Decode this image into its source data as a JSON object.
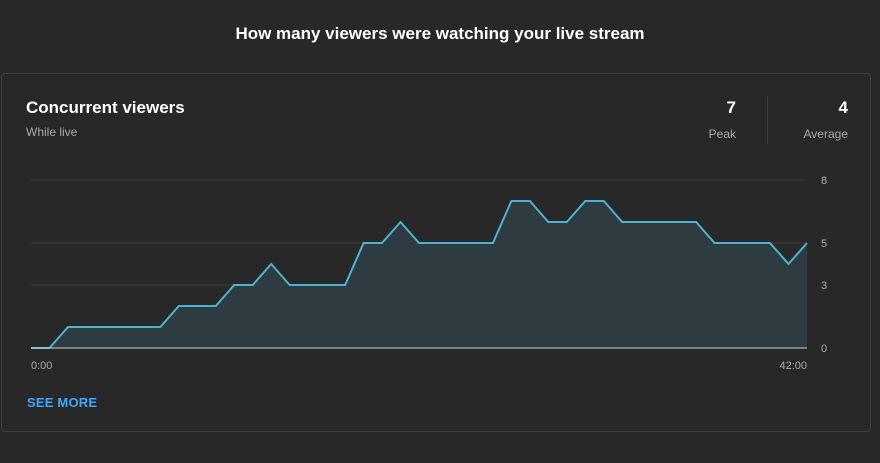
{
  "page": {
    "title": "How many viewers were watching your live stream"
  },
  "card": {
    "title": "Concurrent viewers",
    "subtitle": "While live",
    "stats": [
      {
        "value": "7",
        "label": "Peak"
      },
      {
        "value": "4",
        "label": "Average"
      }
    ],
    "see_more_label": "SEE MORE"
  },
  "chart_data": {
    "type": "area",
    "title": "",
    "xlabel": "",
    "ylabel": "",
    "x_tick_labels": [
      "0:00",
      "42:00"
    ],
    "x_range_minutes": [
      0,
      42
    ],
    "y_ticks": [
      0,
      3,
      5,
      8
    ],
    "y_tick_labels": [
      "0",
      "3",
      "5",
      "8"
    ],
    "ylim": [
      0,
      8
    ],
    "grid": true,
    "series": [
      {
        "x": [
          0,
          1.0,
          2.0,
          3.0,
          7.0,
          8.0,
          10.0,
          11.0,
          12.0,
          13.0,
          14.0,
          15.0,
          17.0,
          18.0,
          19.0,
          20.0,
          21.0,
          22.0,
          25.0,
          26.0,
          27.0,
          28.0,
          29.0,
          30.0,
          31.0,
          32.0,
          33.0,
          36.0,
          37.0,
          40.0,
          41.0,
          42.0
        ],
        "y": [
          0,
          0,
          1,
          1,
          1,
          2,
          2,
          3,
          3,
          4,
          3,
          3,
          3,
          5,
          5,
          6,
          5,
          5,
          5,
          7,
          7,
          6,
          6,
          7,
          7,
          6,
          6,
          6,
          5,
          5,
          4,
          5
        ]
      }
    ],
    "colors": {
      "line": "#4db3d4",
      "area": "#2e3b40",
      "grid": "#3a3a3a",
      "baseline": "#cccccc"
    }
  }
}
